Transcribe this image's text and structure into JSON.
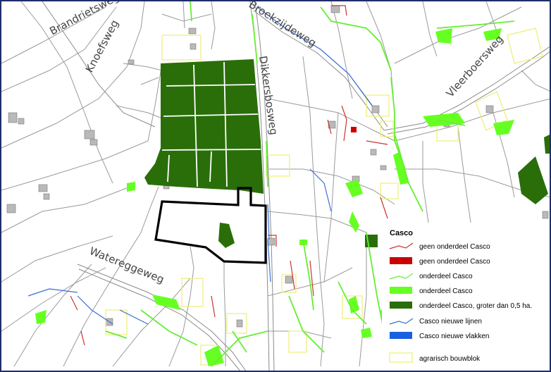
{
  "roads": {
    "brandrietsweg": "Brandrietsweg",
    "knoefsweg": "Knoefsweg",
    "broekzijdeweg": "Broekzijdeweg",
    "dikkersbosweg": "Dikkersbosweg",
    "vleerboersweg": "Vleerboersweg",
    "watereggeweg": "Watereggeweg"
  },
  "legend": {
    "title": "Casco",
    "items": [
      {
        "label": "geen onderdeel Casco",
        "kind": "line",
        "color": "#cc3333"
      },
      {
        "label": "geen onderdeel Casco",
        "kind": "fill",
        "color": "#cc0000"
      },
      {
        "label": "onderdeel Casco",
        "kind": "line",
        "color": "#66ee33"
      },
      {
        "label": "onderdeel Casco",
        "kind": "fill",
        "color": "#66ff22"
      },
      {
        "label": "onderdeel Casco, groter dan 0,5 ha.",
        "kind": "fill",
        "color": "#2a6e0a"
      },
      {
        "label": "Casco nieuwe lijnen",
        "kind": "line",
        "color": "#3a6ed6"
      },
      {
        "label": "Casco nieuwe vlakken",
        "kind": "fill",
        "color": "#1a5fe0"
      },
      {
        "label": "agrarisch bouwblok",
        "kind": "outline",
        "color": "#eeee77"
      }
    ]
  },
  "colors": {
    "frame": "#1f2d6b",
    "parcel_line": "#9a9a9a",
    "building": "#b9b9b9",
    "casco_dark": "#2a6e0a",
    "casco_light": "#66ff22",
    "bouwblok": "#eeee77",
    "plan_boundary": "#000000"
  }
}
